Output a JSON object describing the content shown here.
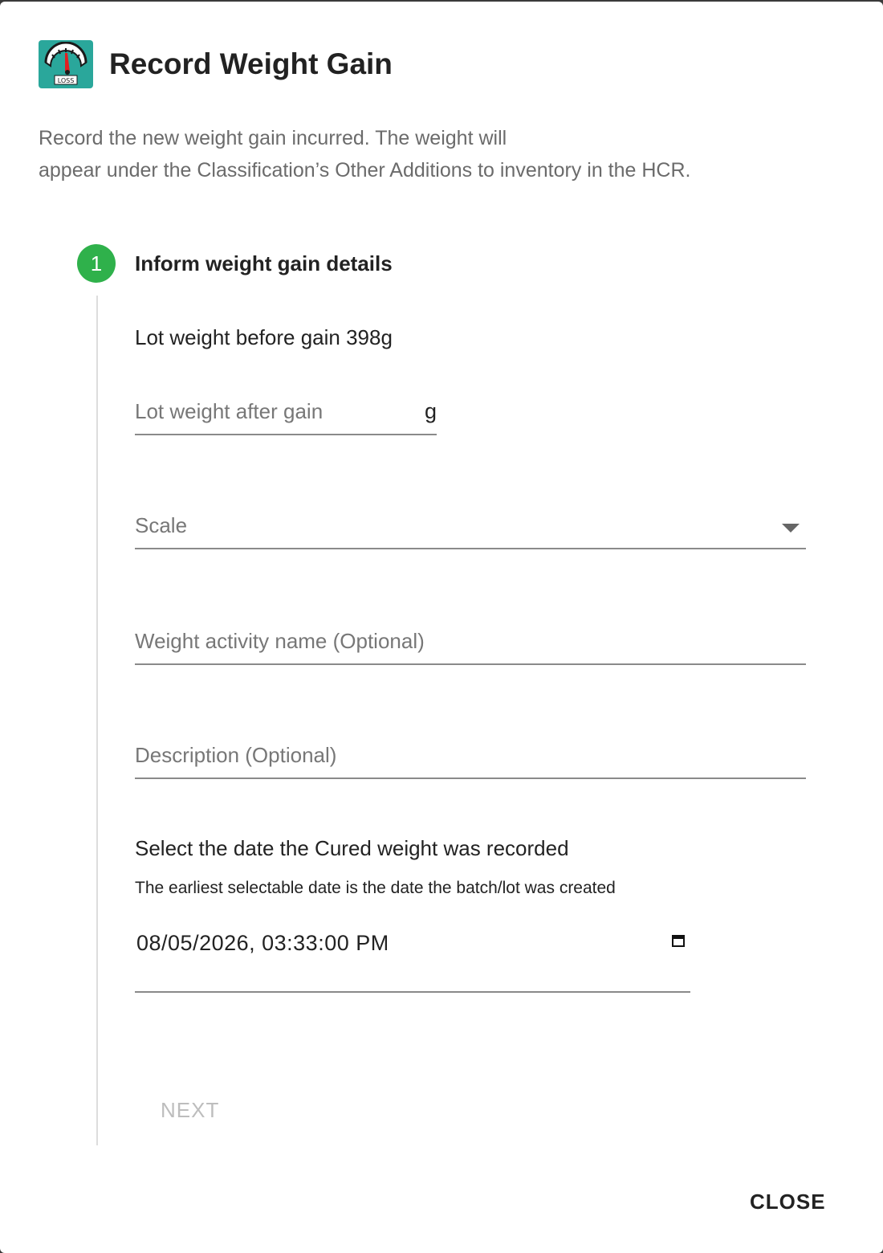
{
  "dialog": {
    "title": "Record Weight Gain",
    "logo_icon": "weight-scale-icon",
    "logo_text": "LOSS",
    "logo_color": "#2aa79b",
    "intro_line1": "Record the new weight gain incurred. The weight will",
    "intro_line2": "appear under the Classification’s Other Additions to inventory in the HCR."
  },
  "step": {
    "number": "1",
    "title": "Inform weight gain details",
    "color": "#2fb14b"
  },
  "form": {
    "lot_before_label": "Lot weight before gain 398g",
    "lot_after_placeholder": "Lot weight after gain",
    "lot_after_unit": "g",
    "scale_label": "Scale",
    "activity_name_placeholder": "Weight activity name (Optional)",
    "description_placeholder": "Description (Optional)",
    "date_title": "Select the date the Cured weight was recorded",
    "date_hint": "The earliest selectable date is the date the batch/lot was created",
    "date_value": "08/05/2026, 03:33:00 PM",
    "date_icon": "calendar-icon"
  },
  "actions": {
    "next_label": "NEXT",
    "close_label": "CLOSE"
  }
}
